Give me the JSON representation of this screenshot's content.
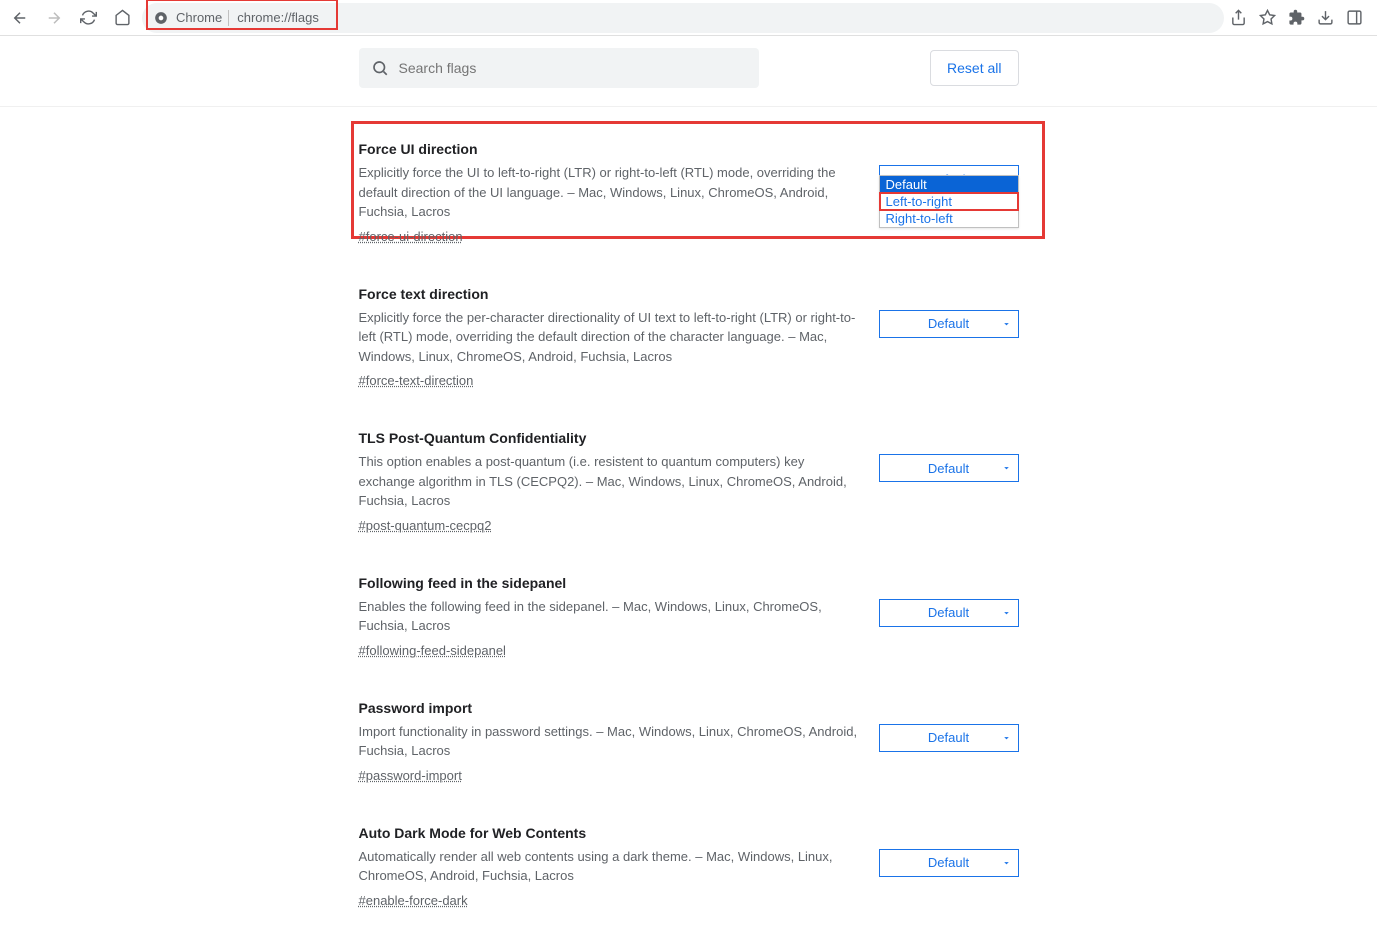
{
  "toolbar": {
    "site_label": "Chrome",
    "url": "chrome://flags"
  },
  "search": {
    "placeholder": "Search flags"
  },
  "reset_label": "Reset all",
  "dropdown": {
    "opt_default": "Default",
    "opt_ltr": "Left-to-right",
    "opt_rtl": "Right-to-left"
  },
  "flags": [
    {
      "title": "Force UI direction",
      "desc": "Explicitly force the UI to left-to-right (LTR) or right-to-left (RTL) mode, overriding the default direction of the UI language. – Mac, Windows, Linux, ChromeOS, Android, Fuchsia, Lacros",
      "anchor": "#force-ui-direction",
      "value": "Default"
    },
    {
      "title": "Force text direction",
      "desc": "Explicitly force the per-character directionality of UI text to left-to-right (LTR) or right-to-left (RTL) mode, overriding the default direction of the character language. – Mac, Windows, Linux, ChromeOS, Android, Fuchsia, Lacros",
      "anchor": "#force-text-direction",
      "value": "Default"
    },
    {
      "title": "TLS Post-Quantum Confidentiality",
      "desc": "This option enables a post-quantum (i.e. resistent to quantum computers) key exchange algorithm in TLS (CECPQ2). – Mac, Windows, Linux, ChromeOS, Android, Fuchsia, Lacros",
      "anchor": "#post-quantum-cecpq2",
      "value": "Default"
    },
    {
      "title": "Following feed in the sidepanel",
      "desc": "Enables the following feed in the sidepanel. – Mac, Windows, Linux, ChromeOS, Fuchsia, Lacros",
      "anchor": "#following-feed-sidepanel",
      "value": "Default"
    },
    {
      "title": "Password import",
      "desc": "Import functionality in password settings. – Mac, Windows, Linux, ChromeOS, Android, Fuchsia, Lacros",
      "anchor": "#password-import",
      "value": "Default"
    },
    {
      "title": "Auto Dark Mode for Web Contents",
      "desc": "Automatically render all web contents using a dark theme. – Mac, Windows, Linux, ChromeOS, Android, Fuchsia, Lacros",
      "anchor": "#enable-force-dark",
      "value": "Default"
    }
  ]
}
